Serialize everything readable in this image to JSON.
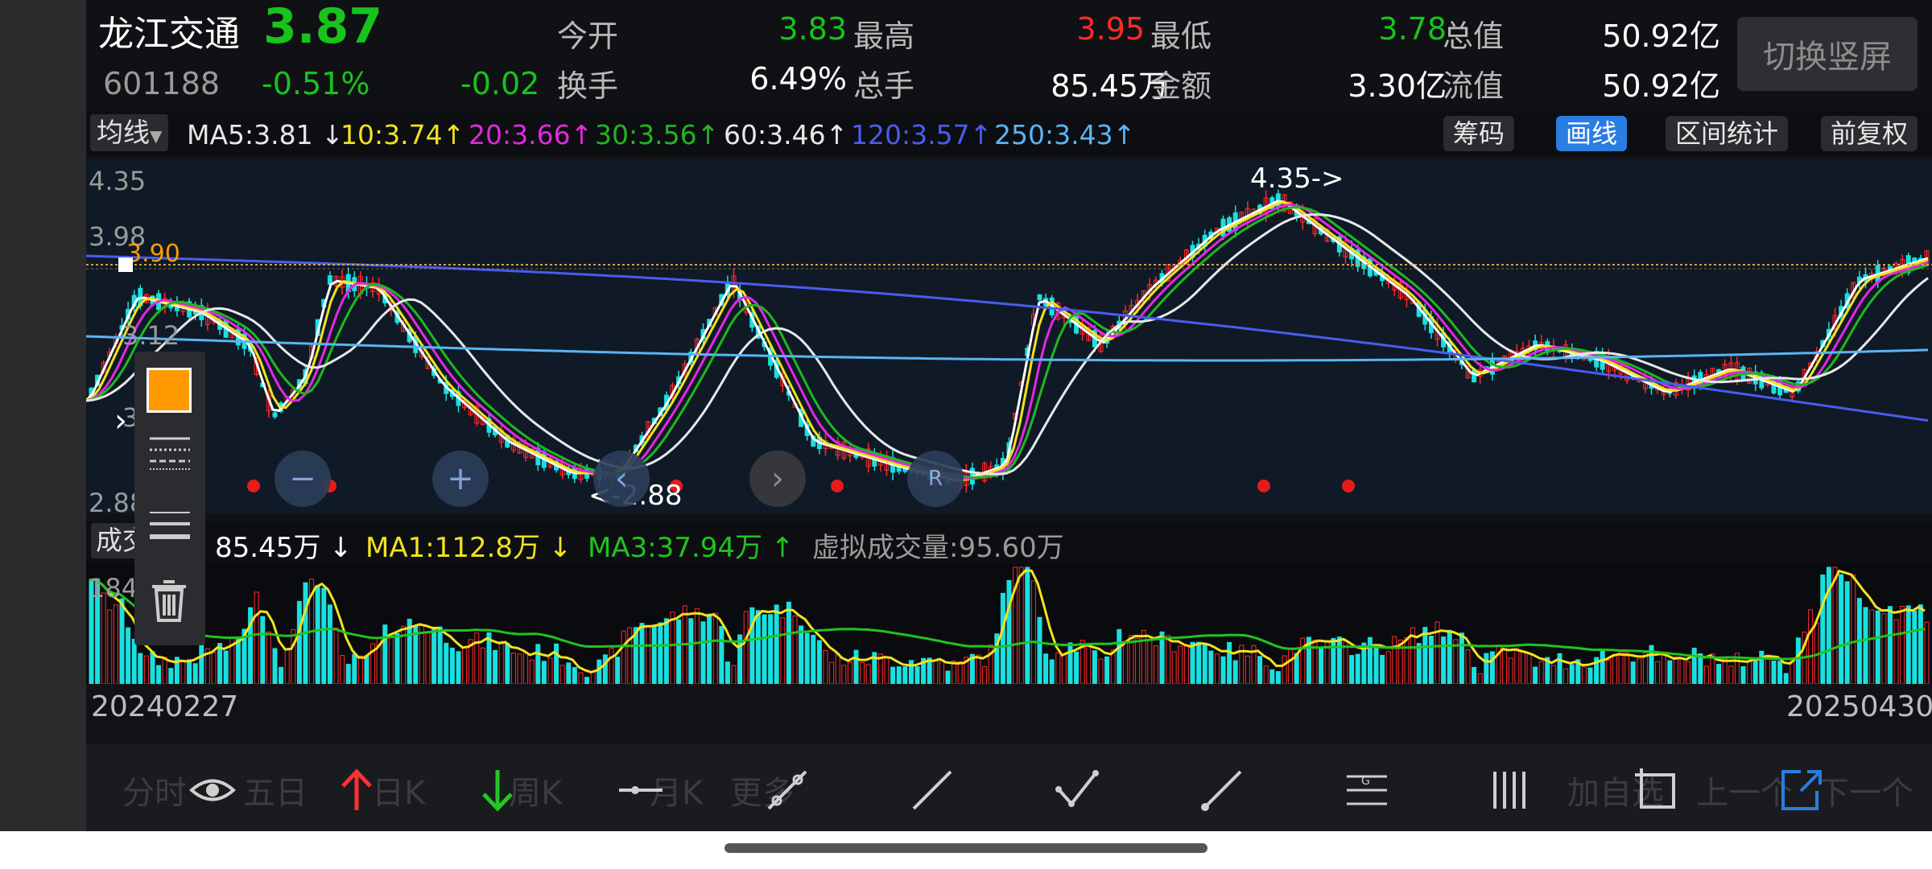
{
  "stock": {
    "name": "龙江交通",
    "price": "3.87",
    "code": "601188",
    "change_pct": "-0.51%",
    "change": "-0.02"
  },
  "quote": {
    "open_label": "今开",
    "open": "3.83",
    "high_label": "最高",
    "high": "3.95",
    "low_label": "最低",
    "low": "3.78",
    "total_value_label": "总值",
    "total_value": "50.92亿",
    "turnover_label": "换手",
    "turnover": "6.49%",
    "total_hands_label": "总手",
    "total_hands": "85.45万",
    "amount_label": "金额",
    "amount": "3.30亿",
    "float_value_label": "流值",
    "float_value": "50.92亿"
  },
  "switch_button": "切换竖屏",
  "ma_bar": {
    "selector": "均线",
    "items": [
      {
        "text": "MA5:3.81",
        "arrow": "↓",
        "color": "#ffffff"
      },
      {
        "text": "10:3.74",
        "arrow": "↑",
        "color": "#f2e21f"
      },
      {
        "text": "20:3.66",
        "arrow": "↑",
        "color": "#e02ae0"
      },
      {
        "text": "30:3.56",
        "arrow": "↑",
        "color": "#21b621"
      },
      {
        "text": "60:3.46",
        "arrow": "↑",
        "color": "#e8e8e8"
      },
      {
        "text": "120:3.57",
        "arrow": "↑",
        "color": "#4a5cf0"
      },
      {
        "text": "250:3.43",
        "arrow": "↑",
        "color": "#5ab4f5"
      }
    ],
    "buttons": [
      "筹码",
      "画线",
      "区间统计",
      "前复权"
    ]
  },
  "price_axis": [
    "4.35",
    "3.98",
    "3.12",
    "3.2",
    "2.88"
  ],
  "annotations": {
    "high_marker": "4.35->",
    "low_marker": "<-2.88",
    "line_price": "3.90"
  },
  "volume_bar": {
    "label": "成交量",
    "volume": "85.45万",
    "volume_arrow": "↓",
    "ma1": "MA1:112.8万",
    "ma1_arrow": "↓",
    "ma3": "MA3:37.94万",
    "ma3_arrow": "↑",
    "virtual": "虚拟成交量:95.60万"
  },
  "volume_axis": "184.9",
  "dates": {
    "start": "20240227",
    "end": "20250430"
  },
  "bottom_ghost": [
    "分时",
    "五日",
    "日K",
    "周K",
    "月K",
    "更多",
    "加自选",
    "上一个",
    "下一个"
  ],
  "colors": {
    "up": "#ff2a2a",
    "down": "#19e0e0",
    "accent": "#2a7de1",
    "orange": "#ff9a00"
  }
}
